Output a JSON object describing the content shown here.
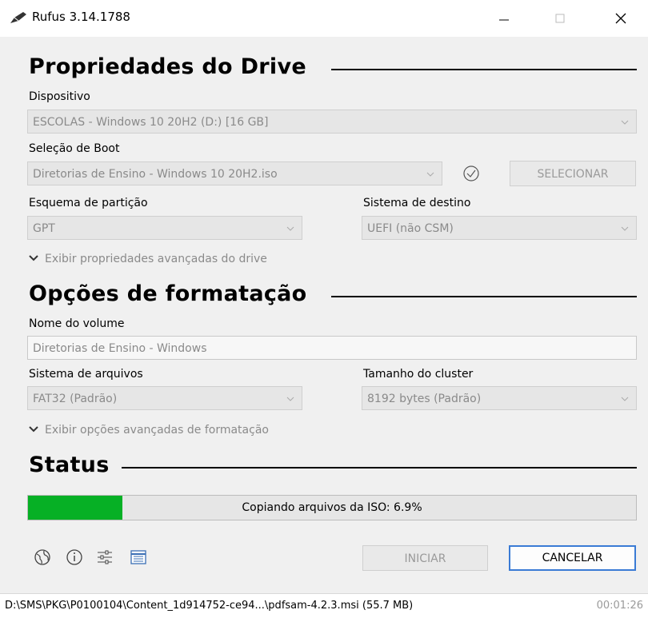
{
  "window": {
    "title": "Rufus 3.14.1788"
  },
  "drive": {
    "heading": "Propriedades do Drive",
    "device_label": "Dispositivo",
    "device_value": "ESCOLAS - Windows 10 20H2 (D:) [16 GB]",
    "boot_label": "Seleção de Boot",
    "boot_value": "Diretorias de Ensino - Windows 10 20H2.iso",
    "select_button": "SELECIONAR",
    "partition_label": "Esquema de partição",
    "partition_value": "GPT",
    "target_label": "Sistema de destino",
    "target_value": "UEFI (não CSM)",
    "advanced_toggle": "Exibir propriedades avançadas do drive"
  },
  "format": {
    "heading": "Opções de formatação",
    "volume_label": "Nome do volume",
    "volume_value": "Diretorias de Ensino - Windows",
    "fs_label": "Sistema de arquivos",
    "fs_value": "FAT32 (Padrão)",
    "cluster_label": "Tamanho do cluster",
    "cluster_value": "8192 bytes (Padrão)",
    "advanced_toggle": "Exibir opções avançadas de formatação"
  },
  "status": {
    "heading": "Status",
    "progress_text": "Copiando arquivos da ISO: 6.9%",
    "progress_fraction": 0.155
  },
  "buttons": {
    "start": "INICIAR",
    "cancel": "CANCELAR"
  },
  "icons": [
    "globe-icon",
    "info-icon",
    "settings-icon",
    "log-icon"
  ],
  "statusbar": {
    "path": "D:\\SMS\\PKG\\P0100104\\Content_1d914752-ce94...\\pdfsam-4.2.3.msi (55.7 MB)",
    "time": "00:01:26"
  },
  "colors": {
    "progress": "#06b025",
    "focus": "#3a7bd5"
  }
}
